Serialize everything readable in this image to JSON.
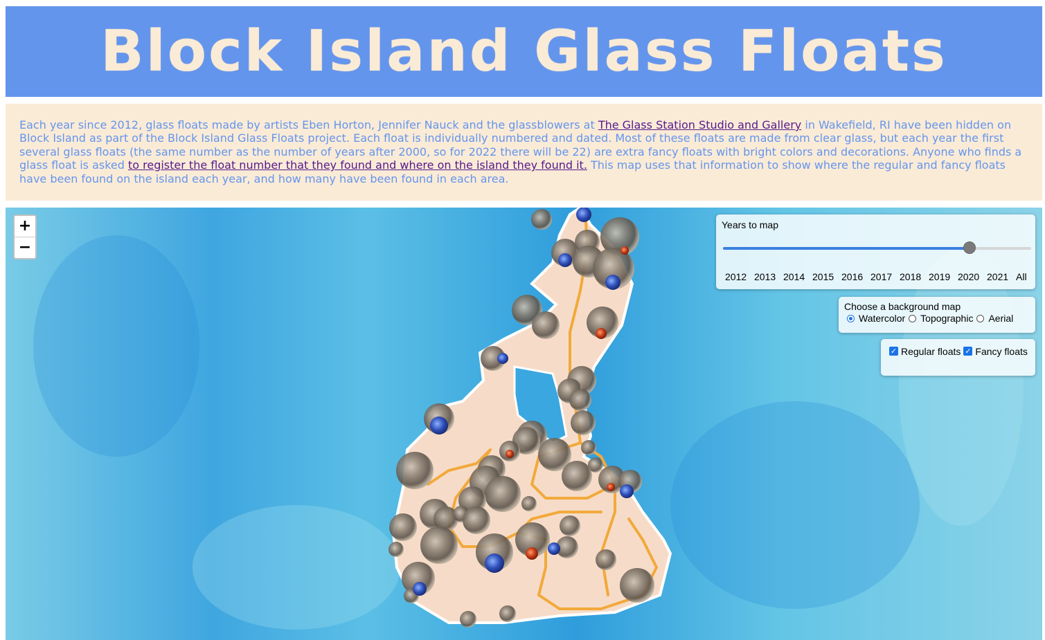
{
  "header": {
    "title": "Block Island Glass Floats"
  },
  "intro": {
    "text_1": "Each year since 2012, glass floats made by artists Eben Horton, Jennifer Nauck and the glassblowers at ",
    "link_1": "The Glass Station Studio and Gallery",
    "text_2": " in Wakefield, RI have been hidden on Block Island as part of the Block Island Glass Floats project. Each float is individually numbered and dated. Most of these floats are made from clear glass, but each year the first several glass floats (the same number as the number of years after 2000, so for 2022 there will be 22) are extra fancy floats with bright colors and decorations. Anyone who finds a glass float is asked ",
    "link_2": "to register the float number that they found and where on the island they found it.",
    "text_3": " This map uses that information to show where the regular and fancy floats have been found on the island each year, and how many have been found in each area."
  },
  "map": {
    "zoom_in": "+",
    "zoom_out": "−",
    "years_control": {
      "title": "Years to map",
      "options": [
        "2012",
        "2013",
        "2014",
        "2015",
        "2016",
        "2017",
        "2018",
        "2019",
        "2020",
        "2021",
        "All"
      ],
      "selected": "2020",
      "selected_fraction": 0.8
    },
    "background_control": {
      "title": "Choose a background map",
      "options": [
        "Watercolor",
        "Topographic",
        "Aerial"
      ],
      "selected": "Watercolor"
    },
    "float_filter": {
      "options": [
        {
          "label": "Regular floats",
          "checked": true
        },
        {
          "label": "Fancy floats",
          "checked": true
        }
      ]
    },
    "colors": {
      "water": "#4fb3e0",
      "land": "#f6dcc8",
      "road": "#f2a93b",
      "regular_float": "#8a7f73",
      "fancy_blue": "#2f4fb8",
      "fancy_red": "#c43a17"
    }
  }
}
